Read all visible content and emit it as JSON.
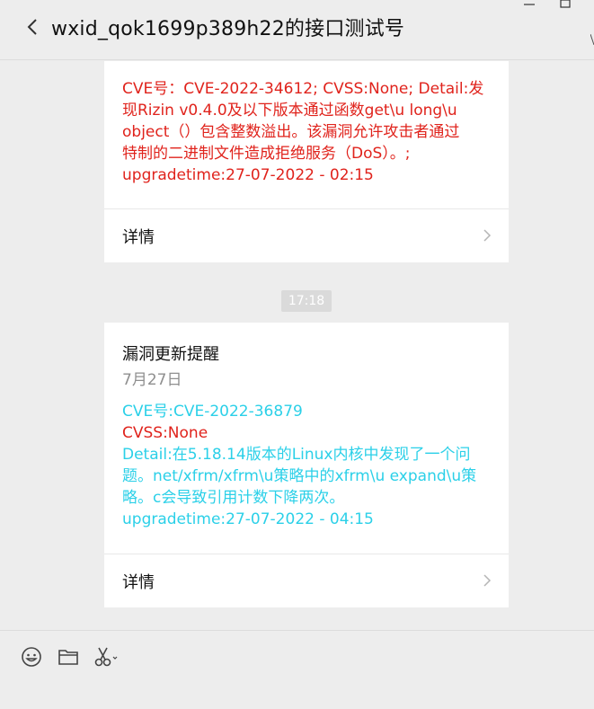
{
  "header": {
    "title": "wxid_qok1699p389h22的接口测试号"
  },
  "messages": [
    {
      "content_lines": [
        "CVE号：CVE-2022-34612; CVSS:None; Detail:发",
        "现Rizin v0.4.0及以下版本通过函数get\\u long\\u",
        "object（）包含整数溢出。该漏洞允许攻击者通过",
        "特制的二进制文件造成拒绝服务（DoS）。;",
        "upgradetime:27-07-2022 - 02:15"
      ],
      "detail_label": "详情"
    },
    {
      "timestamp": "17:18",
      "title": "漏洞更新提醒",
      "date": "7月27日",
      "lines": [
        {
          "text": "CVE号:CVE-2022-36879",
          "color": "cyan"
        },
        {
          "text": "CVSS:None",
          "color": "red"
        },
        {
          "text": "Detail:在5.18.14版本的Linux内核中发现了一个问",
          "color": "cyan"
        },
        {
          "text": "题。net/xfrm/xfrm\\u策略中的xfrm\\u expand\\u策",
          "color": "cyan"
        },
        {
          "text": "略。c会导致引用计数下降两次。",
          "color": "cyan"
        },
        {
          "text": "upgradetime:27-07-2022 - 04:15",
          "color": "cyan"
        }
      ],
      "detail_label": "详情"
    }
  ],
  "colors": {
    "red": "#e0231c",
    "cyan": "#2bd0e8"
  },
  "toolbar": {
    "icons": [
      "emoji-icon",
      "folder-icon",
      "scissors-icon"
    ]
  }
}
